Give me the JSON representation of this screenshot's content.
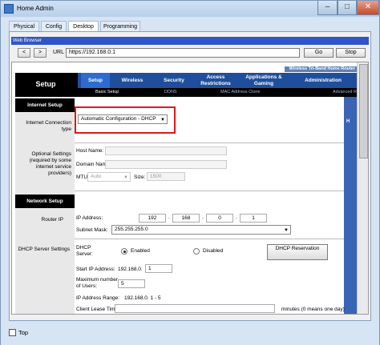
{
  "window": {
    "title": "Home Admin"
  },
  "tabs": [
    "Physical",
    "Config",
    "Desktop",
    "Programming"
  ],
  "browser": {
    "title": "Web Browser",
    "back": "<",
    "forward": ">",
    "url_label": "URL",
    "url": "https://192.168.0.1",
    "go": "Go",
    "stop": "Stop"
  },
  "router": {
    "banner": "Wireless Tri-Band Home Router",
    "page_title": "Setup",
    "menu": [
      "Setup",
      "Wireless",
      "Security",
      "Access Restrictions",
      "Applications & Gaming",
      "Administration"
    ],
    "submenu": [
      "Basic Setup",
      "DDNS",
      "MAC Address Clone",
      "Advanced R"
    ],
    "right_strip": "H"
  },
  "internet_setup": {
    "section": "Internet Setup",
    "conn_label": "Internet Connection type",
    "conn_value": "Automatic Configuration - DHCP"
  },
  "optional": {
    "label": "Optional Settings (required by some internet service providers)",
    "host_label": "Host Name:",
    "domain_label": "Domain Name:",
    "mtu_label": "MTU:",
    "mtu_mode": "Auto",
    "size_label": "Size:",
    "size_value": "1500"
  },
  "network_setup": {
    "section": "Network Setup",
    "router_ip_label": "Router IP",
    "ip_label": "IP Address:",
    "ip": [
      "192",
      "168",
      "0",
      "1"
    ],
    "mask_label": "Subnet Mask:",
    "mask_value": "255.255.255.0"
  },
  "dhcp": {
    "label": "DHCP Server Settings",
    "server_label": "DHCP Server:",
    "enabled": "Enabled",
    "disabled": "Disabled",
    "reservation": "DHCP Reservation",
    "start_label": "Start IP Address:",
    "start_prefix": "192.168.0.",
    "start_value": "1",
    "max_label": "Maximum number of Users:",
    "max_value": "5",
    "range_label": "IP Address Range:",
    "range_value": "192.168.0. 1 - 5",
    "lease_label": "Client Lease Time:",
    "lease_value": "minutes (0 means one day)"
  },
  "footer": {
    "top_label": "Top"
  }
}
